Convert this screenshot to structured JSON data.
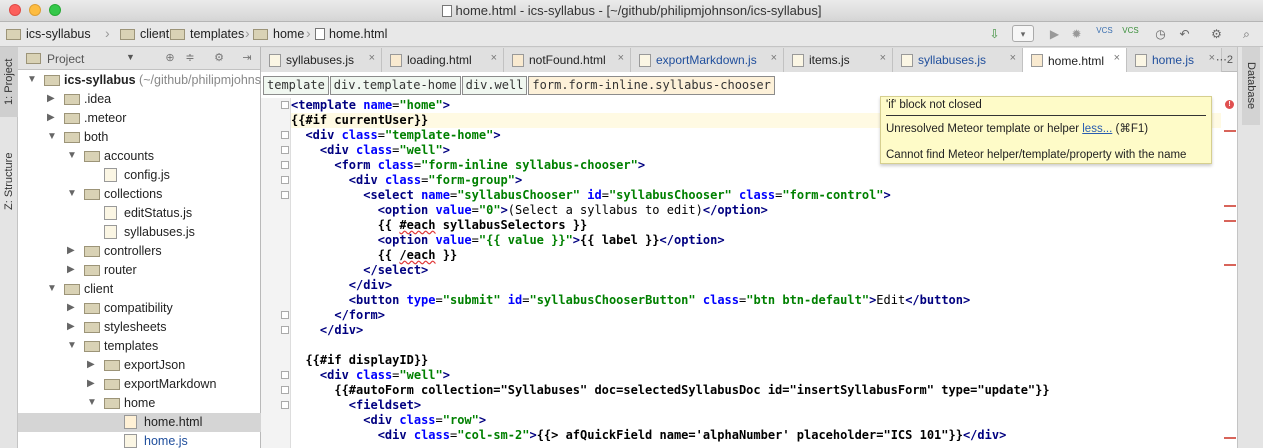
{
  "window": {
    "title": "home.html - ics-syllabus - [~/github/philipmjohnson/ics-syllabus]"
  },
  "nav": {
    "breadcrumb": [
      "ics-syllabus",
      "client",
      "templates",
      "home",
      "home.html"
    ],
    "vcs_label": "VCS"
  },
  "left_stripe": {
    "project_tab": "1: Project",
    "structure_tab": "Z: Structure"
  },
  "project_panel": {
    "title": "Project",
    "tree": [
      {
        "label": "ics-syllabus",
        "suffix": " (~/github/philipmjohnson/ics-syllabus)",
        "type": "folder",
        "depth": 0,
        "expanded": true,
        "bold": true
      },
      {
        "label": ".idea",
        "type": "folder",
        "depth": 1,
        "expanded": false
      },
      {
        "label": ".meteor",
        "type": "folder",
        "depth": 1,
        "expanded": false
      },
      {
        "label": "both",
        "type": "folder",
        "depth": 1,
        "expanded": true
      },
      {
        "label": "accounts",
        "type": "folder",
        "depth": 2,
        "expanded": true
      },
      {
        "label": "config.js",
        "type": "js",
        "depth": 3
      },
      {
        "label": "collections",
        "type": "folder",
        "depth": 2,
        "expanded": true
      },
      {
        "label": "editStatus.js",
        "type": "js",
        "depth": 3
      },
      {
        "label": "syllabuses.js",
        "type": "js",
        "depth": 3
      },
      {
        "label": "controllers",
        "type": "folder",
        "depth": 2,
        "expanded": false
      },
      {
        "label": "router",
        "type": "folder",
        "depth": 2,
        "expanded": false
      },
      {
        "label": "client",
        "type": "folder",
        "depth": 1,
        "expanded": true
      },
      {
        "label": "compatibility",
        "type": "folder",
        "depth": 2,
        "expanded": false
      },
      {
        "label": "stylesheets",
        "type": "folder",
        "depth": 2,
        "expanded": false
      },
      {
        "label": "templates",
        "type": "folder",
        "depth": 2,
        "expanded": true
      },
      {
        "label": "exportJson",
        "type": "folder",
        "depth": 3,
        "expanded": false
      },
      {
        "label": "exportMarkdown",
        "type": "folder",
        "depth": 3,
        "expanded": false
      },
      {
        "label": "home",
        "type": "folder",
        "depth": 3,
        "expanded": true
      },
      {
        "label": "home.html",
        "type": "html",
        "depth": 4,
        "selected": true
      },
      {
        "label": "home.js",
        "type": "js",
        "depth": 4,
        "blue": true
      }
    ]
  },
  "tabs": [
    {
      "label": "syllabuses.js",
      "kind": "js",
      "blue": false,
      "active": false
    },
    {
      "label": "loading.html",
      "kind": "html",
      "blue": false,
      "active": false
    },
    {
      "label": "notFound.html",
      "kind": "html",
      "blue": false,
      "active": false
    },
    {
      "label": "exportMarkdown.js",
      "kind": "js",
      "blue": true,
      "active": false
    },
    {
      "label": "items.js",
      "kind": "js",
      "blue": false,
      "active": false
    },
    {
      "label": "syllabuses.js",
      "kind": "js",
      "blue": true,
      "active": false
    },
    {
      "label": "home.html",
      "kind": "html",
      "blue": false,
      "active": true
    },
    {
      "label": "home.js",
      "kind": "js",
      "blue": true,
      "active": false
    }
  ],
  "tab_overflow": "⋯2",
  "right_stripe": {
    "database_tab": "Database"
  },
  "editor": {
    "element_path": [
      "template",
      "div.template-home",
      "div.well",
      "form.form-inline.syllabus-chooser"
    ],
    "tooltip": {
      "line1": "'if' block not closed",
      "line2_prefix": "Unresolved Meteor template or helper ",
      "line2_link": "less...",
      "line2_suffix": " (⌘F1)",
      "line3": "Cannot find Meteor helper/template/property with the name"
    },
    "lines": [
      "<template name=\"home\">",
      "{{#if currentUser}}",
      "  <div class=\"template-home\">",
      "    <div class=\"well\">",
      "      <form class=\"form-inline syllabus-chooser\">",
      "        <div class=\"form-group\">",
      "          <select name=\"syllabusChooser\" id=\"syllabusChooser\" class=\"form-control\">",
      "            <option value=\"0\">(Select a syllabus to edit)</option>",
      "            {{ #each syllabusSelectors }}",
      "            <option value=\"{{ value }}\">{{ label }}</option>",
      "            {{ /each }}",
      "          </select>",
      "        </div>",
      "        <button type=\"submit\" id=\"syllabusChooserButton\" class=\"btn btn-default\">Edit</button>",
      "      </form>",
      "    </div>",
      "",
      "  {{#if displayID}}",
      "    <div class=\"well\">",
      "      {{#autoForm collection=\"Syllabuses\" doc=selectedSyllabusDoc id=\"insertSyllabusForm\" type=\"update\"}}",
      "        <fieldset>",
      "          <div class=\"row\">",
      "            <div class=\"col-sm-2\">{{> afQuickField name='alphaNumber' placeholder=\"ICS 101\"}}</div>"
    ]
  }
}
